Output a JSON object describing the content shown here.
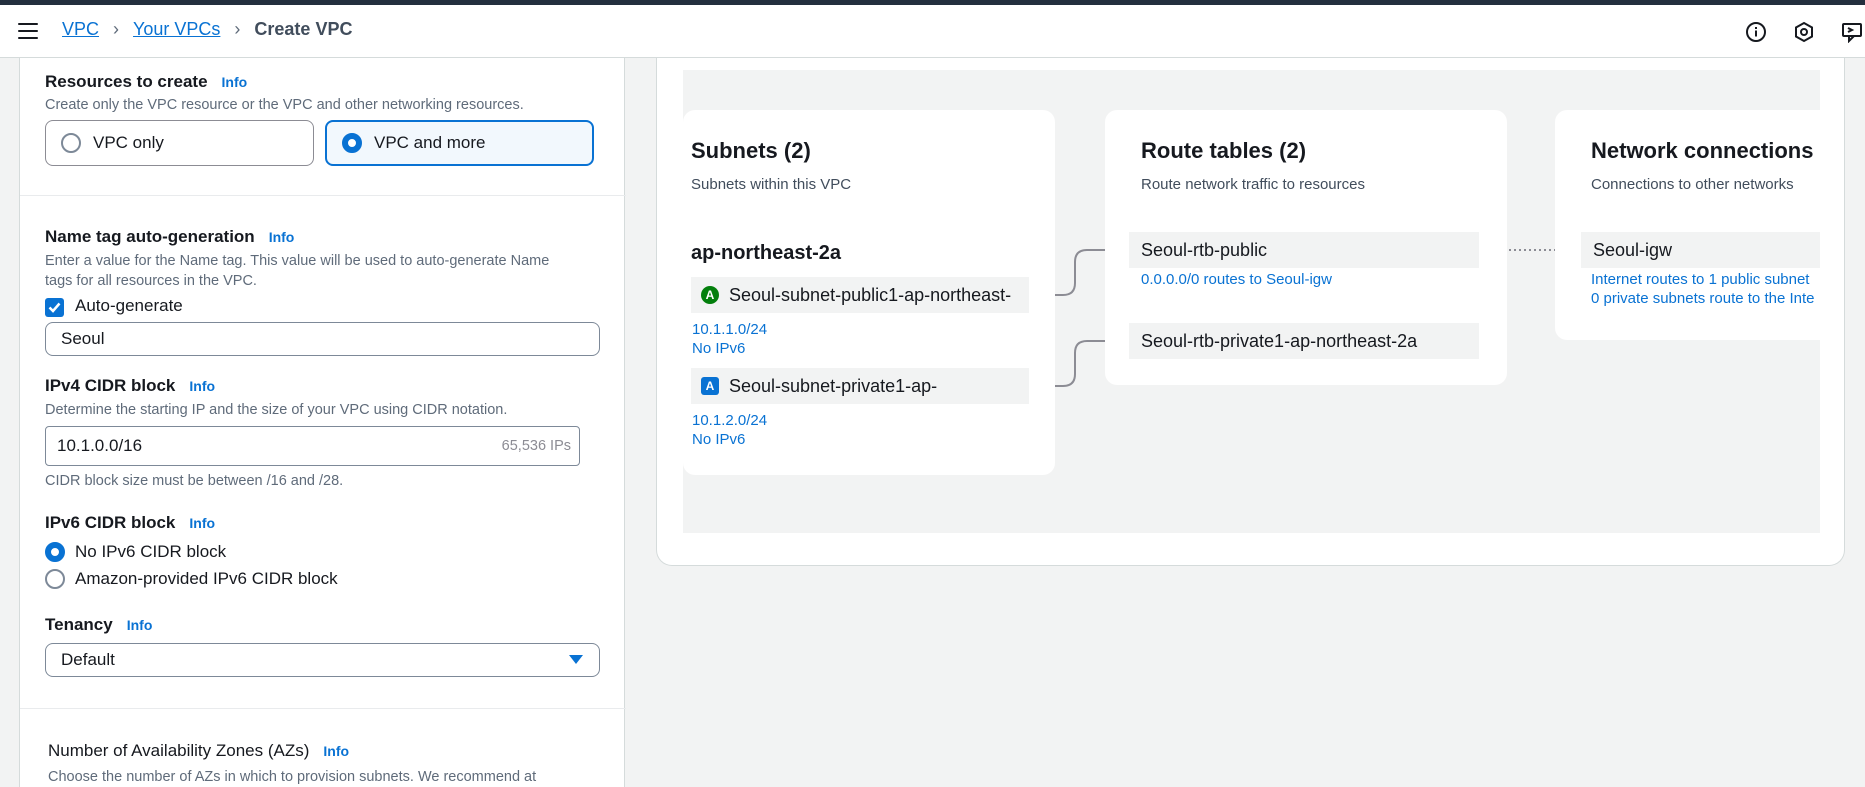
{
  "breadcrumb": {
    "root": "VPC",
    "parent": "Your VPCs",
    "current": "Create VPC"
  },
  "form": {
    "resources": {
      "label": "Resources to create",
      "info": "Info",
      "description": "Create only the VPC resource or the VPC and other networking resources.",
      "option_vpc_only": "VPC only",
      "option_vpc_and_more": "VPC and more",
      "selected": "VPC and more"
    },
    "name_tag": {
      "label": "Name tag auto-generation",
      "info": "Info",
      "description_line1": "Enter a value for the Name tag. This value will be used to auto-generate Name",
      "description_line2": "tags for all resources in the VPC.",
      "auto_generate_label": "Auto-generate",
      "auto_generate_checked": true,
      "value": "Seoul"
    },
    "ipv4": {
      "label": "IPv4 CIDR block",
      "info": "Info",
      "description": "Determine the starting IP and the size of your VPC using CIDR notation.",
      "value": "10.1.0.0/16",
      "ip_count": "65,536 IPs",
      "constraint": "CIDR block size must be between /16 and /28."
    },
    "ipv6": {
      "label": "IPv6 CIDR block",
      "info": "Info",
      "option_none": "No IPv6 CIDR block",
      "option_amazon": "Amazon-provided IPv6 CIDR block",
      "selected": "No IPv6 CIDR block"
    },
    "tenancy": {
      "label": "Tenancy",
      "info": "Info",
      "value": "Default"
    },
    "azs": {
      "label": "Number of Availability Zones (AZs)",
      "info": "Info",
      "description": "Choose the number of AZs in which to provision subnets. We recommend at"
    }
  },
  "preview": {
    "subnets": {
      "title": "Subnets (2)",
      "subtitle": "Subnets within this VPC",
      "az": "ap-northeast-2a",
      "items": [
        {
          "name": "Seoul-subnet-public1-ap-northeast-",
          "badge": "A",
          "cidr": "10.1.1.0/24",
          "ipv6": "No IPv6"
        },
        {
          "name": "Seoul-subnet-private1-ap-",
          "badge": "A",
          "cidr": "10.1.2.0/24",
          "ipv6": "No IPv6"
        }
      ]
    },
    "route_tables": {
      "title": "Route tables (2)",
      "subtitle": "Route network traffic to resources",
      "items": [
        {
          "name": "Seoul-rtb-public",
          "route": "0.0.0.0/0 routes to Seoul-igw"
        },
        {
          "name": "Seoul-rtb-private1-ap-northeast-2a"
        }
      ]
    },
    "network": {
      "title": "Network connections",
      "subtitle": "Connections to other networks",
      "igw": "Seoul-igw",
      "line1": "Internet routes to 1 public subnet",
      "line2": "0 private subnets route to the Inte"
    }
  }
}
